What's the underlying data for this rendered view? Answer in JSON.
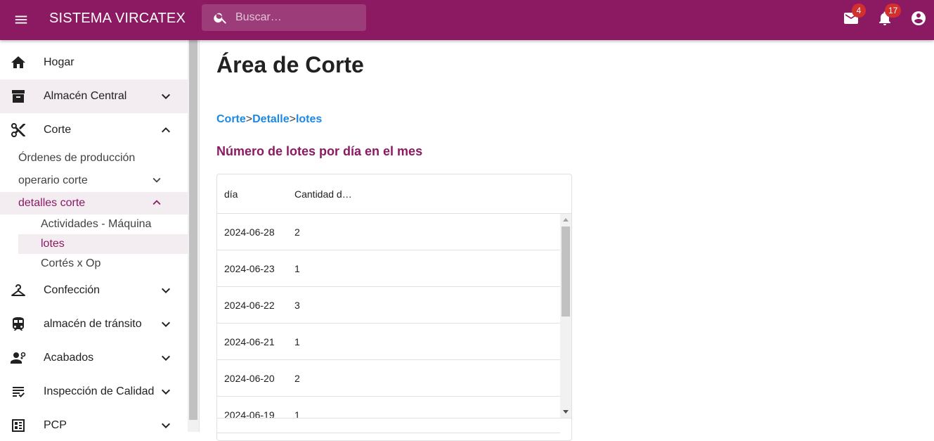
{
  "appbar": {
    "title": "SISTEMA VIRCATEX",
    "search_placeholder": "Buscar…",
    "mail_count": "4",
    "notifications_count": "17",
    "color": "#8b1a62"
  },
  "sidebar": {
    "items": [
      {
        "label": "Hogar",
        "icon": "home-icon"
      },
      {
        "label": "Almacén Central",
        "icon": "archive-icon"
      },
      {
        "label": "Corte",
        "icon": "scissors-icon"
      },
      {
        "label": "Confección",
        "icon": "hanger-icon"
      },
      {
        "label": "almacén de tránsito",
        "icon": "train-icon"
      },
      {
        "label": "Acabados",
        "icon": "person-gear-icon"
      },
      {
        "label": "Inspección de Calidad",
        "icon": "checklist-icon"
      },
      {
        "label": "PCP",
        "icon": "dashboard-icon"
      }
    ],
    "corte_sub": [
      {
        "label": "Órdenes de producción"
      },
      {
        "label": "operario corte"
      },
      {
        "label": "detalles corte"
      }
    ],
    "detalles_sub": [
      {
        "label": "Actividades - Máquina"
      },
      {
        "label": "lotes"
      },
      {
        "label": "Cortés x Op"
      }
    ]
  },
  "main": {
    "title": "Área de Corte",
    "breadcrumb": [
      "Corte",
      "Detalle",
      "lotes"
    ],
    "breadcrumb_sep": ">",
    "section_title": "Número de lotes por día en el mes",
    "table": {
      "columns": [
        "día",
        "Cantidad d…"
      ],
      "rows": [
        [
          "2024-06-28",
          "2"
        ],
        [
          "2024-06-23",
          "1"
        ],
        [
          "2024-06-22",
          "3"
        ],
        [
          "2024-06-21",
          "1"
        ],
        [
          "2024-06-20",
          "2"
        ],
        [
          "2024-06-19",
          "1"
        ]
      ]
    }
  }
}
